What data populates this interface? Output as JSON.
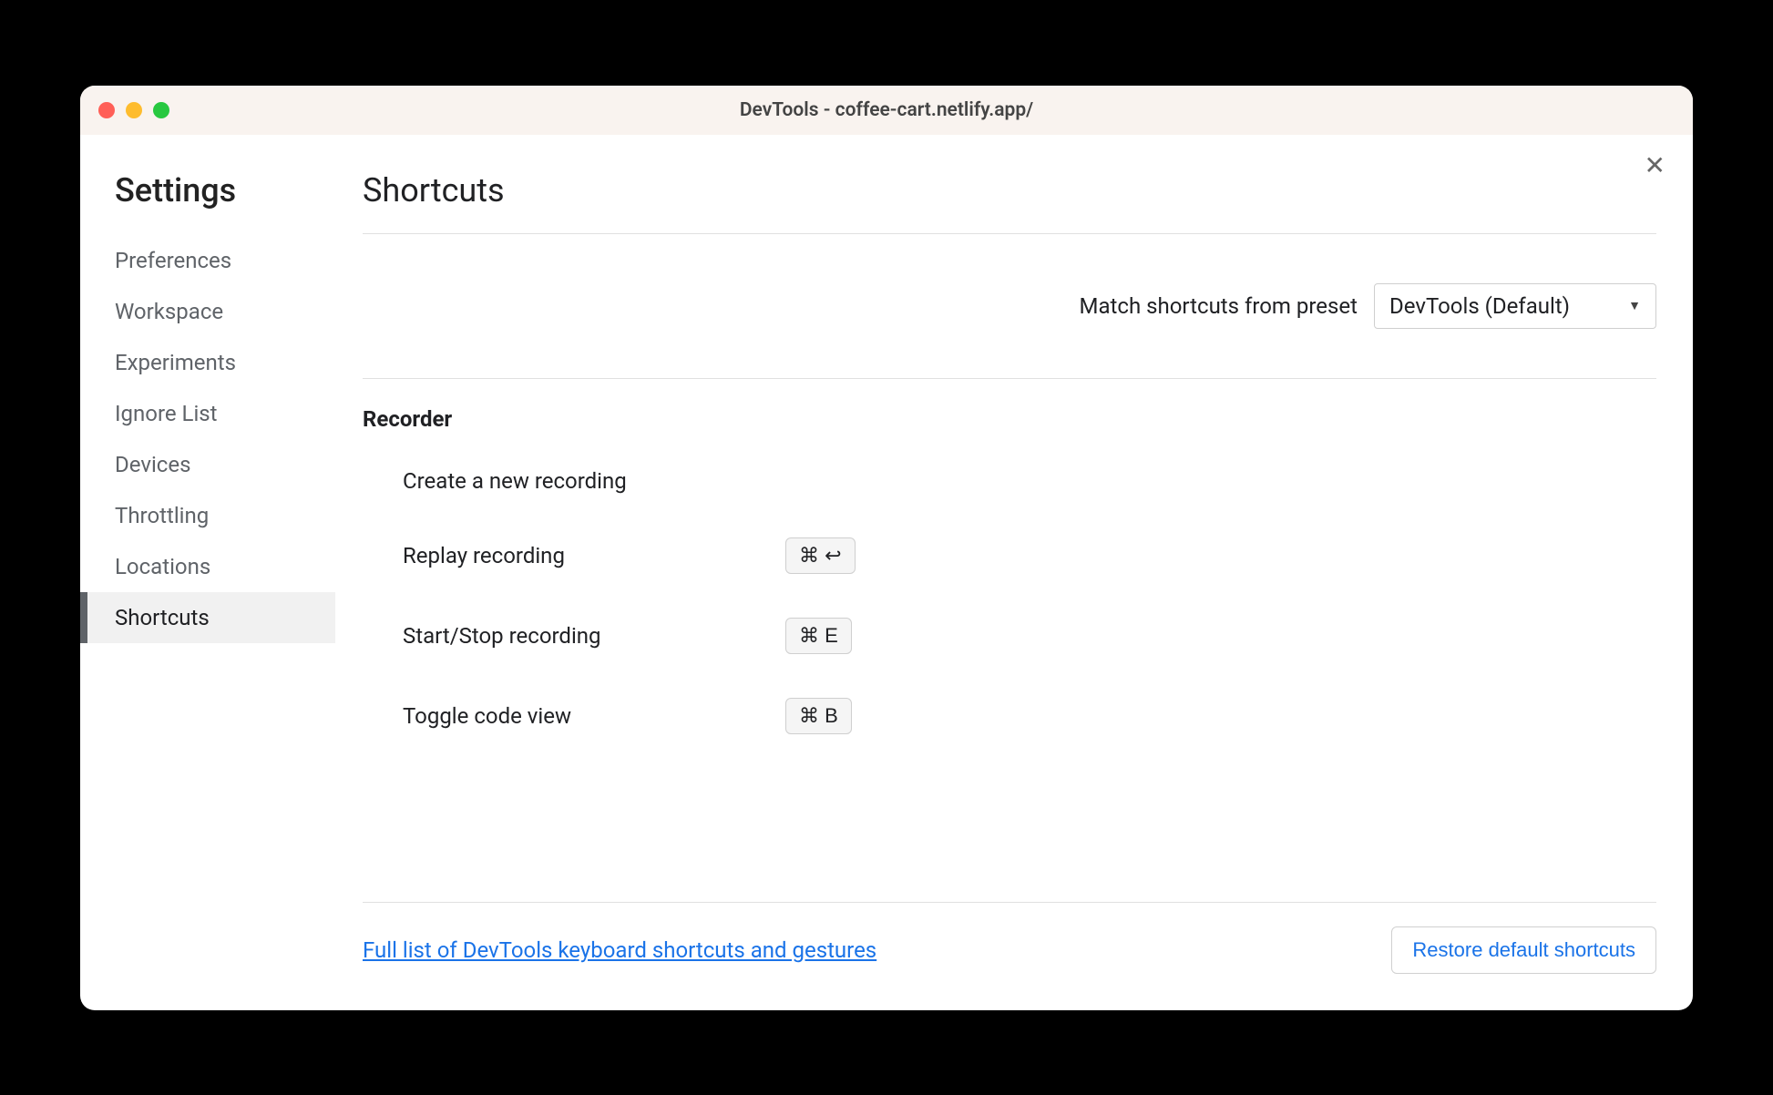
{
  "window": {
    "title": "DevTools - coffee-cart.netlify.app/"
  },
  "sidebar": {
    "title": "Settings",
    "items": [
      {
        "label": "Preferences",
        "active": false
      },
      {
        "label": "Workspace",
        "active": false
      },
      {
        "label": "Experiments",
        "active": false
      },
      {
        "label": "Ignore List",
        "active": false
      },
      {
        "label": "Devices",
        "active": false
      },
      {
        "label": "Throttling",
        "active": false
      },
      {
        "label": "Locations",
        "active": false
      },
      {
        "label": "Shortcuts",
        "active": true
      }
    ]
  },
  "main": {
    "title": "Shortcuts",
    "preset": {
      "label": "Match shortcuts from preset",
      "value": "DevTools (Default)"
    },
    "section": {
      "title": "Recorder",
      "rows": [
        {
          "label": "Create a new recording",
          "keys": ""
        },
        {
          "label": "Replay recording",
          "keys": "⌘  ↩"
        },
        {
          "label": "Start/Stop recording",
          "keys": "⌘  E"
        },
        {
          "label": "Toggle code view",
          "keys": "⌘  B"
        }
      ]
    },
    "footer": {
      "link": "Full list of DevTools keyboard shortcuts and gestures",
      "restore": "Restore default shortcuts"
    }
  }
}
